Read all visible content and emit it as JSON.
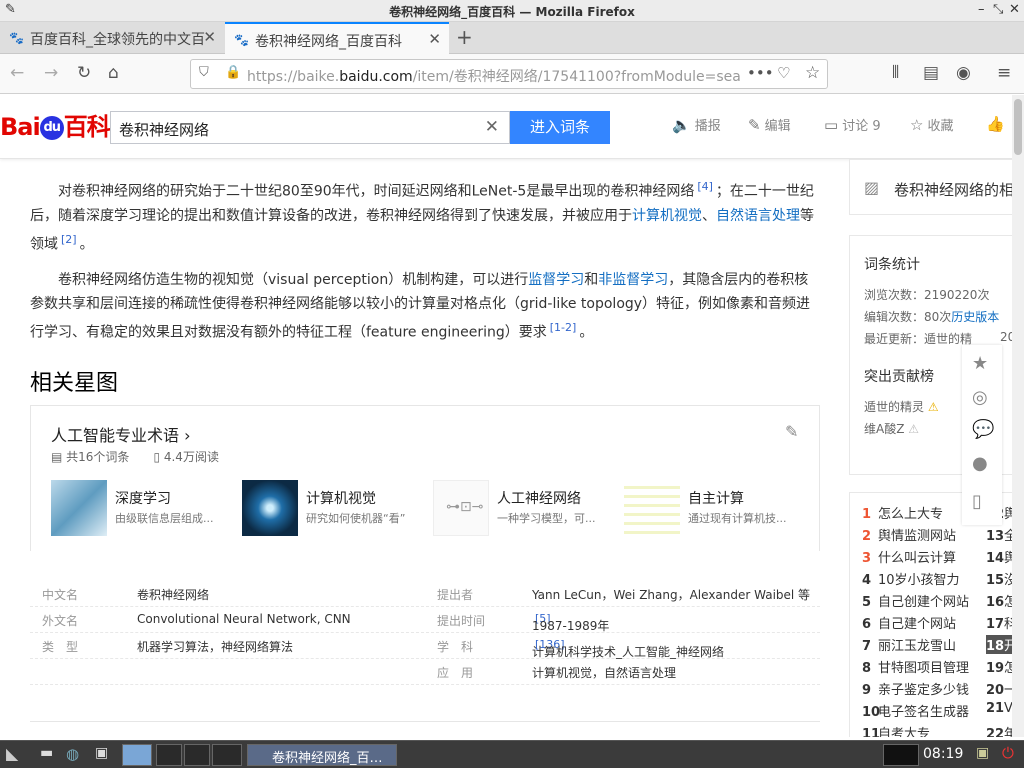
{
  "window": {
    "title": "卷积神经网络_百度百科 — Mozilla Firefox"
  },
  "tabs": [
    {
      "label": "百度百科_全球领先的中文百"
    },
    {
      "label": "卷积神经网络_百度百科"
    }
  ],
  "url": {
    "prefix": "https://baike.",
    "domain": "baidu.com",
    "rest": "/item/卷积神经网络/17541100?fromModule=sea"
  },
  "search": {
    "value": "卷积神经网络",
    "button": "进入词条"
  },
  "header_actions": [
    "播报",
    "编辑",
    "讨论 9",
    "收藏"
  ],
  "paragraphs": {
    "p1_a": "对卷积神经网络的研究始于二十世纪80至90年代，时间延迟网络和LeNet-5是最早出现的卷积神经网络",
    "p1_ref1": "[4]",
    "p1_b": "；在二十一世纪后，随着深度学习理论的提出和数值计算设备的改进，卷积神经网络得到了快速发展，并被应用于",
    "p1_link1": "计算机视觉",
    "p1_sep": "、",
    "p1_link2": "自然语言处理",
    "p1_c": "等领域",
    "p1_ref2": "[2]",
    "p1_end": "。",
    "p2_a": "卷积神经网络仿造生物的视知觉（visual perception）机制构建，可以进行",
    "p2_link1": "监督学习",
    "p2_and": "和",
    "p2_link2": "非监督学习",
    "p2_b": "，其隐含层内的卷积核参数共享和层间连接的稀疏性使得卷积神经网络能够以较小的计算量对格点化（grid-like topology）特征，例如像素和音频进行学习、有稳定的效果且对数据没有额外的特征工程（feature engineering）要求",
    "p2_ref": "[1-2]",
    "p2_end": "。"
  },
  "star": {
    "heading": "相关星图",
    "title": "人工智能专业术语",
    "count": "共16个词条",
    "reads": "4.4万阅读",
    "items": [
      {
        "name": "深度学习",
        "desc": "由级联信息层组成..."
      },
      {
        "name": "计算机视觉",
        "desc": "研究如何使机器“看”"
      },
      {
        "name": "人工神经网络",
        "desc": "一种学习模型，可..."
      },
      {
        "name": "自主计算",
        "desc": "通过现有计算机技..."
      }
    ]
  },
  "basic": [
    {
      "k1": "中文名",
      "v1": "卷积神经网络",
      "k2": "提出者",
      "v2": "Yann LeCun，Wei Zhang，Alexander Waibel 等",
      "r2": ""
    },
    {
      "k1": "外文名",
      "v1": "Convolutional Neural Network, CNN",
      "k2": "提出时间",
      "v2": "1987-1989年",
      "r2": "[5]"
    },
    {
      "k1": "类　型",
      "v1": "机器学习算法，神经网络算法",
      "k2": "学　科",
      "v2": "计算机科学技术_人工智能_神经网络",
      "r2": "[136]"
    },
    {
      "k1": "",
      "v1": "",
      "k2": "应　用",
      "v2": "计算机视觉，自然语言处理",
      "r2": ""
    }
  ],
  "side": {
    "album": "卷积神经网络的相",
    "stats_title": "词条统计",
    "views": "浏览次数：2190220次",
    "edits": "编辑次数：80次",
    "history": "历史版本",
    "updated": "最近更新：遁世的精",
    "updated_tail": "20",
    "contrib_title": "突出贡献榜",
    "contrib": [
      "遁世的精灵",
      "维A酸Z"
    ],
    "ranks": [
      {
        "n": "1",
        "t": "怎么上大专"
      },
      {
        "n": "2",
        "t": "舆情监测网站"
      },
      {
        "n": "3",
        "t": "什么叫云计算"
      },
      {
        "n": "4",
        "t": "10岁小孩智力"
      },
      {
        "n": "5",
        "t": "自己创建个网站"
      },
      {
        "n": "6",
        "t": "自己建个网站"
      },
      {
        "n": "7",
        "t": "丽江玉龙雪山"
      },
      {
        "n": "8",
        "t": "甘特图项目管理"
      },
      {
        "n": "9",
        "t": "亲子鉴定多少钱"
      },
      {
        "n": "10",
        "t": "电子签名生成器"
      },
      {
        "n": "11",
        "t": "自考大专"
      }
    ],
    "ranks2": [
      {
        "n": "12",
        "t": "舆"
      },
      {
        "n": "13",
        "t": "全"
      },
      {
        "n": "14",
        "t": "舆"
      },
      {
        "n": "15",
        "t": "沒"
      },
      {
        "n": "16",
        "t": "怎"
      },
      {
        "n": "17",
        "t": "科"
      },
      {
        "n": "18",
        "t": "开"
      },
      {
        "n": "19",
        "t": "怎"
      },
      {
        "n": "20",
        "t": "一"
      },
      {
        "n": "21",
        "t": "V"
      },
      {
        "n": "22",
        "t": "年"
      }
    ]
  },
  "taskbar": {
    "window": "卷积神经网络_百…",
    "clock": "08:19"
  }
}
